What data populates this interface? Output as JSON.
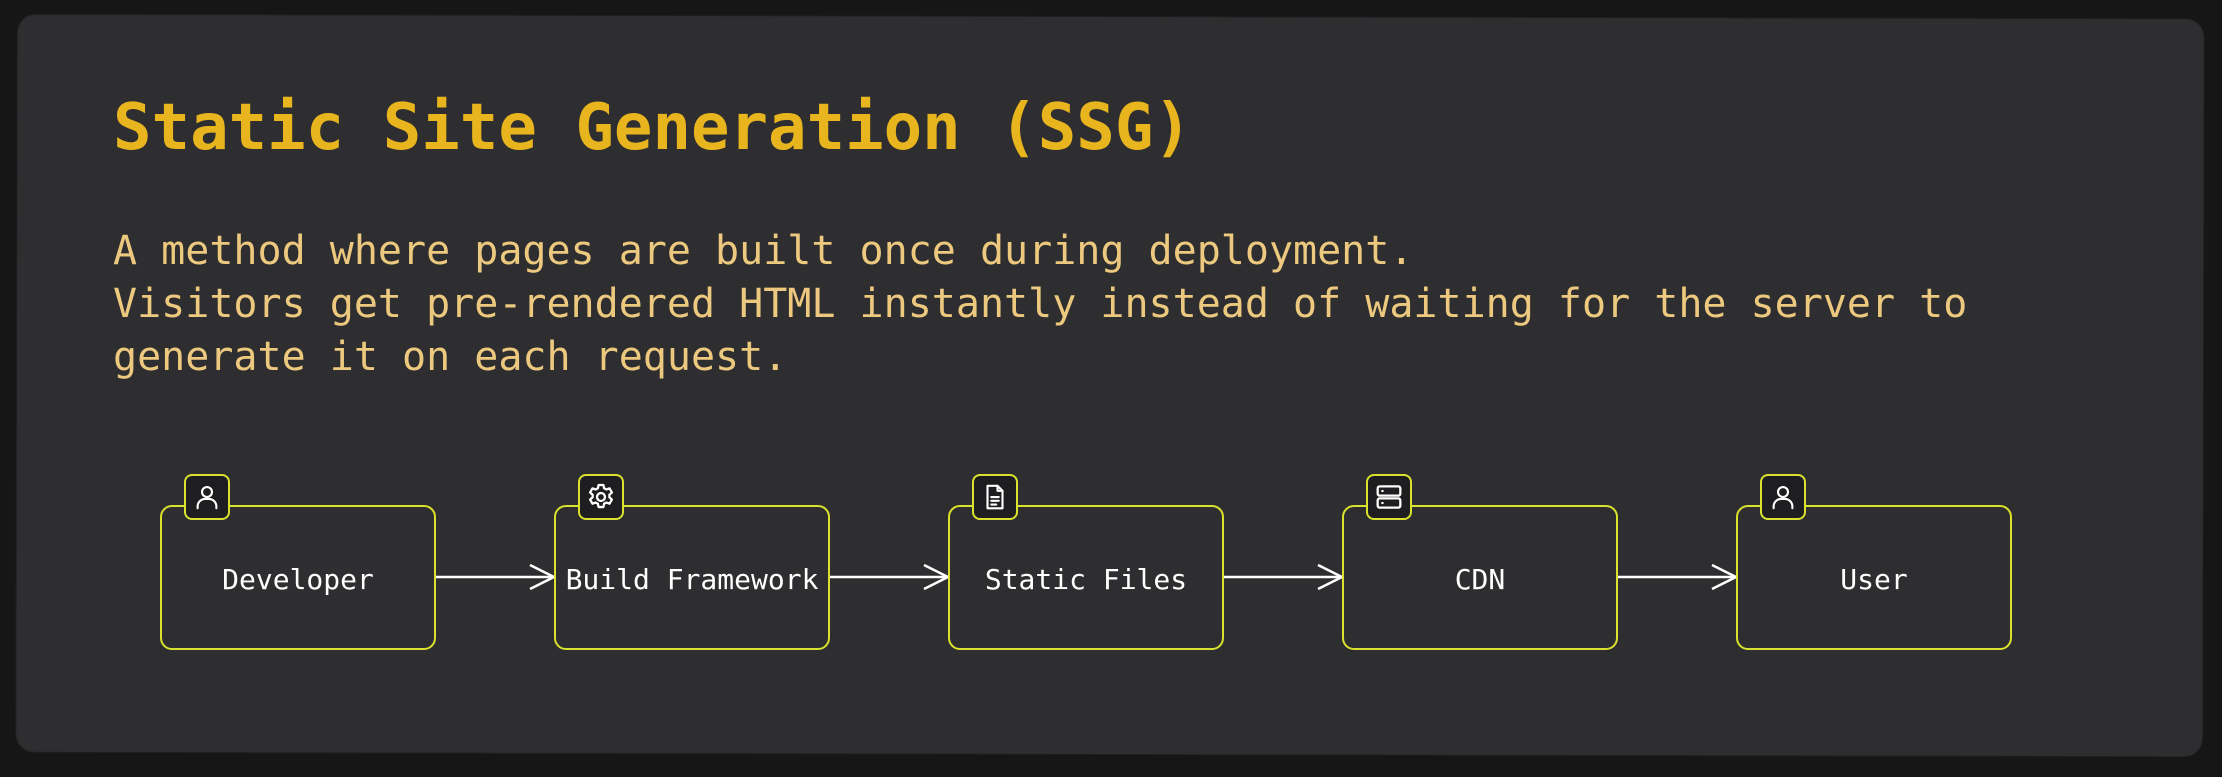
{
  "title": "Static Site Generation (SSG)",
  "description": [
    "A method where pages are built once during deployment.",
    "Visitors get pre-rendered HTML instantly instead of waiting for the server to",
    "generate it on each request."
  ],
  "colors": {
    "accent_title": "#e9b51f",
    "body_text": "#ecc97e",
    "node_border": "#d9e22c",
    "card_background": "#2e2e30",
    "arrow": "#ffffff"
  },
  "flow": {
    "nodes": [
      {
        "label": "Developer",
        "icon": "user-icon"
      },
      {
        "label": "Build Framework",
        "icon": "gear-icon"
      },
      {
        "label": "Static Files",
        "icon": "document-icon"
      },
      {
        "label": "CDN",
        "icon": "server-icon"
      },
      {
        "label": "User",
        "icon": "user-icon"
      }
    ],
    "edges": [
      {
        "from": "Developer",
        "to": "Build Framework"
      },
      {
        "from": "Build Framework",
        "to": "Static Files"
      },
      {
        "from": "Static Files",
        "to": "CDN"
      },
      {
        "from": "CDN",
        "to": "User"
      }
    ]
  }
}
